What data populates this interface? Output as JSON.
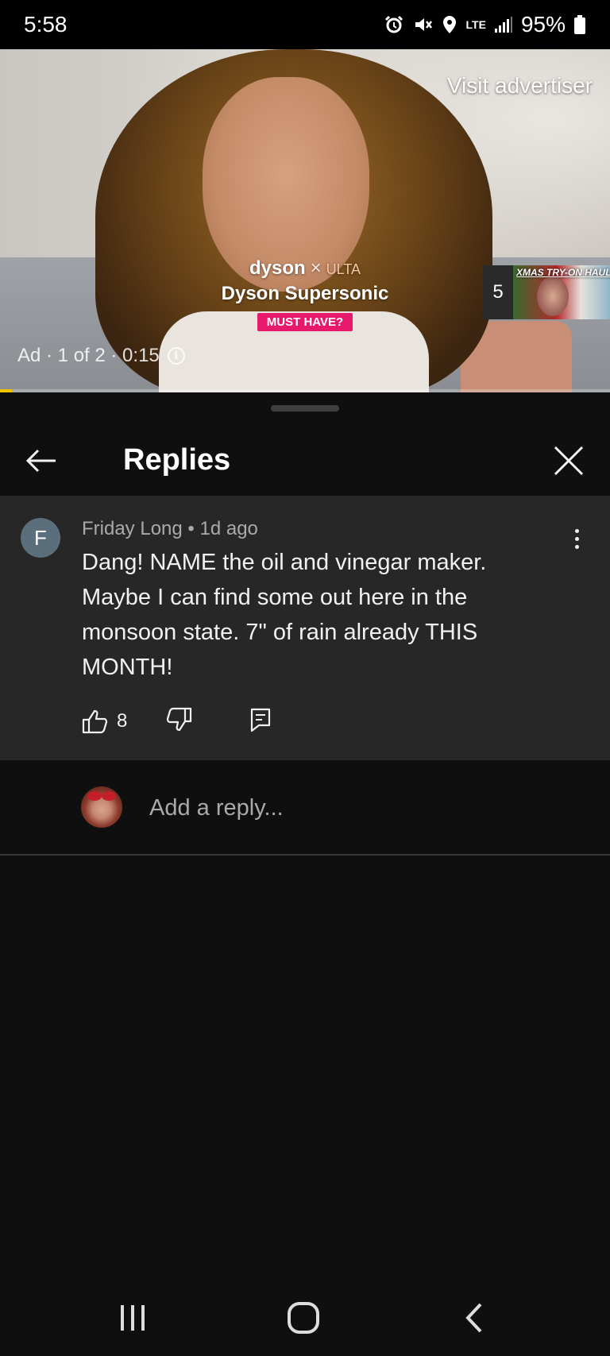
{
  "status_bar": {
    "time": "5:58",
    "network": "LTE",
    "battery": "95%"
  },
  "video": {
    "visit_advertiser": "Visit advertiser",
    "brand_primary": "dyson",
    "brand_separator": "×",
    "brand_secondary": "ULTA",
    "product_title": "Dyson Supersonic",
    "cta_badge": "MUST HAVE?",
    "ad_label": "Ad · 1 of 2 · 0:15",
    "next_up_count": "5",
    "next_up_title": "XMAS TRY-ON HAUL!",
    "progress_fraction": 0.02
  },
  "panel": {
    "title": "Replies"
  },
  "comment": {
    "avatar_letter": "F",
    "author": "Friday Long",
    "separator": "•",
    "time_ago": "1d ago",
    "text": "Dang! NAME the oil and vinegar maker. Maybe I can find some out here in the monsoon state. 7\" of rain already THIS MONTH!",
    "like_count": "8"
  },
  "reply": {
    "placeholder": "Add a reply..."
  },
  "colors": {
    "panel_bg": "#0f0f0f",
    "comment_bg": "#272727",
    "cta_pink": "#e6196b",
    "progress": "#f2c500",
    "avatar_f": "#5a6e7c"
  }
}
